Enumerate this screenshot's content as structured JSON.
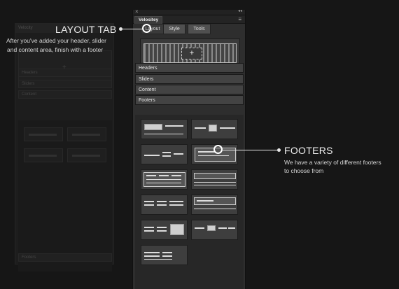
{
  "ghost": {
    "title": "Velocity",
    "items": [
      "Headers",
      "Sliders",
      "Content"
    ],
    "footer": "Footers"
  },
  "panel": {
    "close_glyph": "×",
    "collapse_glyph": "◂◂",
    "tab_title": "Velositey",
    "menu_glyph": "≡",
    "subtabs": [
      "Layout",
      "Style",
      "Tools"
    ],
    "hero_plus": "+",
    "sections": [
      "Headers",
      "Sliders",
      "Content",
      "Footers"
    ]
  },
  "callouts": {
    "layout": {
      "title": "LAYOUT TAB",
      "line1": "After you've added your header, slider",
      "line2": "and content area, finish with a footer"
    },
    "footers": {
      "title": "FOOTERS",
      "line1": "We have a variety of different footers",
      "line2": "to choose from"
    }
  },
  "colors": {
    "background": "#161616",
    "panel": "#2e2e2e",
    "accent": "#ffffff"
  }
}
